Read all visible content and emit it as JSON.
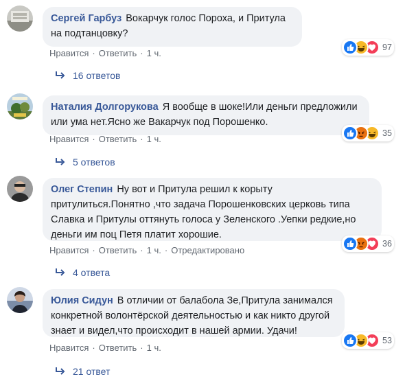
{
  "comments": [
    {
      "author": "Сергей Гарбуз",
      "text": "Вокарчук голос Пороха, и Притула на подтанцовку?",
      "like": "Нравится",
      "reply": "Ответить",
      "time": "1 ч.",
      "edited": "",
      "reaction_count": "97",
      "replies": "16 ответов"
    },
    {
      "author": "Наталия Долгорукова",
      "text": "Я вообще в шоке!Или деньги предложили или ума нет.Ясно же Вакарчук под Порошенко.",
      "like": "Нравится",
      "reply": "Ответить",
      "time": "1 ч.",
      "edited": "",
      "reaction_count": "35",
      "replies": "5 ответов"
    },
    {
      "author": "Олег Степин",
      "text": "Ну вот и Притула решил к корыту притулиться.Понятно ,что задача Порошенковских церковь типа Славка и Притулы оттянуть голоса у Зеленского .Уепки редкие,но деньги им поц Петя платит хорошие.",
      "like": "Нравится",
      "reply": "Ответить",
      "time": "1 ч.",
      "edited": "Отредактировано",
      "reaction_count": "36",
      "replies": "4 ответа"
    },
    {
      "author": "Юлия Сидун",
      "text": "В отличии от балабола Зе,Притула занимался конкретной волонтёрской деятельностью и как никто другой знает и видел,что происходит в нашей армии. Удачи!",
      "like": "Нравится",
      "reply": "Ответить",
      "time": "1 ч.",
      "edited": "",
      "reaction_count": "53",
      "replies": "21 ответ"
    }
  ],
  "colors": {
    "author": "#385898",
    "bubble": "#f0f2f5",
    "meta": "#606770",
    "like_blue": "#1877f2",
    "haha_yellow": "#f7b928",
    "angry_orange": "#e9710f",
    "love_red": "#f33e58"
  },
  "icons": {
    "reactions_1": [
      "like-icon",
      "haha-icon",
      "love-icon"
    ],
    "reactions_2": [
      "like-icon",
      "angry-icon",
      "haha-icon"
    ],
    "reactions_3": [
      "like-icon",
      "angry-icon",
      "love-icon"
    ],
    "reactions_4": [
      "like-icon",
      "haha-icon",
      "love-icon"
    ],
    "reply_arrow": "reply-arrow-icon"
  }
}
